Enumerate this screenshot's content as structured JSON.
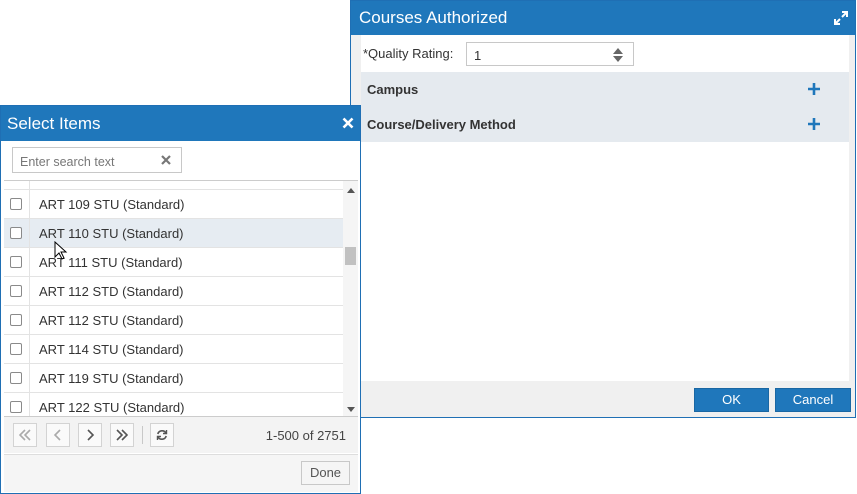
{
  "courses_dialog": {
    "title": "Courses Authorized",
    "quality_rating_label": "*Quality Rating:",
    "quality_rating_value": "1",
    "sections": [
      {
        "label": "Campus"
      },
      {
        "label": "Course/Delivery Method"
      }
    ],
    "ok_label": "OK",
    "cancel_label": "Cancel"
  },
  "select_items": {
    "title": "Select Items",
    "search_placeholder": "Enter search text",
    "items": [
      {
        "label": "ART 109 STU (Standard)"
      },
      {
        "label": "ART 110 STU (Standard)"
      },
      {
        "label": "ART 111 STU (Standard)"
      },
      {
        "label": "ART 112 STD (Standard)"
      },
      {
        "label": "ART 112 STU (Standard)"
      },
      {
        "label": "ART 114 STU (Standard)"
      },
      {
        "label": "ART 119 STU (Standard)"
      },
      {
        "label": "ART 122 STU (Standard)"
      }
    ],
    "pager_info": "1-500 of 2751",
    "done_label": "Done"
  },
  "colors": {
    "title_bar": "#1f77bb",
    "section_bg": "#e5eaef",
    "row_hover": "#e6ecf2"
  },
  "icons": {
    "expand": "expand-icon",
    "close": "close-icon",
    "plus": "plus-icon",
    "clear": "clear-icon",
    "first": "first-page-icon",
    "prev": "prev-page-icon",
    "next": "next-page-icon",
    "last": "last-page-icon",
    "refresh": "refresh-icon"
  }
}
